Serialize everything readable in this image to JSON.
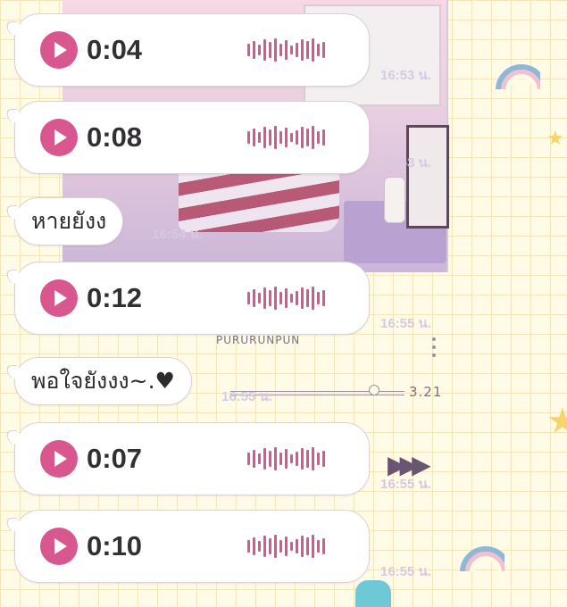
{
  "chat": {
    "messages": [
      {
        "type": "voice",
        "duration": "0:04",
        "time": "16:53 น."
      },
      {
        "type": "voice",
        "duration": "0:08",
        "time": "16:53 น."
      },
      {
        "type": "text",
        "text": "หายยังง",
        "time": "16:54 น."
      },
      {
        "type": "voice",
        "duration": "0:12",
        "time": "16:55 น."
      },
      {
        "type": "text",
        "text": "พอใจยังงง~.♥",
        "time": "16:55 น."
      },
      {
        "type": "voice",
        "duration": "0:07",
        "time": "16:55 น."
      },
      {
        "type": "voice",
        "duration": "0:10",
        "time": "16:55 น."
      }
    ]
  },
  "wallpaper": {
    "brand_text": "PURURUNPUN",
    "track_time": "3.21"
  },
  "colors": {
    "accent": "#d9578f",
    "bubble": "#ffffff",
    "timestamp": "#d8c8e3"
  },
  "icons": {
    "play": "play-icon",
    "waveform": "waveform-icon",
    "fast_forward": "fast-forward-icon"
  }
}
